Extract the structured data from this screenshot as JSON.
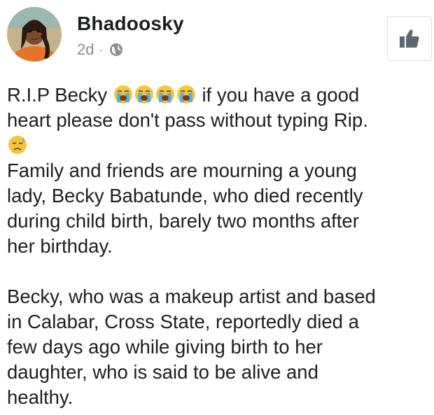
{
  "post": {
    "author": "Bhadoosky",
    "time": "2d",
    "separator": "·",
    "audience_icon": "globe-icon",
    "like_icon": "thumbs-up-icon",
    "intro_text": "R.I.P Becky",
    "intro_emojis": [
      "loudly-crying-face",
      "loudly-crying-face",
      "loudly-crying-face",
      "loudly-crying-face"
    ],
    "intro_after": "if you have a good",
    "line2": "heart please don't pass without typing Rip.",
    "line3_emoji": "sad-but-relieved-face",
    "paragraph1": [
      "Family and friends are mourning a young",
      "lady, Becky Babatunde, who died recently",
      "during child birth, barely two months after",
      "her birthday."
    ],
    "paragraph2": [
      "Becky, who was a makeup artist and based",
      "in Calabar, Cross State, reportedly died a",
      "few days ago while giving birth to her",
      "daughter, who is said to be alive and",
      "healthy."
    ]
  },
  "colors": {
    "text": "#1c1e21",
    "meta": "#8a8d91",
    "emoji_face": "#f7c53a",
    "tears": "#5aaee8",
    "avatar_bg": "#c9a56a",
    "like_icon": "#606770"
  }
}
